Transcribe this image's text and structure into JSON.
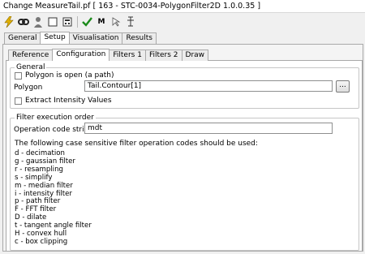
{
  "window": {
    "title": "Change MeasureTail.pf [ 163 - STC-0034-PolygonFilter2D 1.0.0.35 ]"
  },
  "toolbar": {
    "icons": [
      "lightning-icon",
      "link-icon",
      "person-icon",
      "square-icon",
      "calculator-icon",
      "checkmark-icon",
      "m-text",
      "cursor-icon",
      "text-cursor-icon"
    ],
    "m_label": "M"
  },
  "tabs_main": [
    "General",
    "Setup",
    "Visualisation",
    "Results"
  ],
  "tabs_main_active": "Setup",
  "tabs_setup": [
    "Reference",
    "Configuration",
    "Filters 1",
    "Filters 2",
    "Draw"
  ],
  "tabs_setup_active": "Configuration",
  "general_group": {
    "legend": "General",
    "polygon_open_label": "Polygon is open (a path)",
    "polygon_open_checked": false,
    "polygon_label": "Polygon",
    "polygon_value": "Tail.Contour[1]",
    "browse_label": "...",
    "extract_intensity_label": "Extract Intensity Values",
    "extract_intensity_checked": false
  },
  "filter_group": {
    "legend": "Filter execution order",
    "opcode_label": "Operation code string",
    "opcode_value": "mdt",
    "help_intro": "The following case sensitive filter operation codes should be used:",
    "codes": [
      "d - decimation",
      "g - gaussian filter",
      "r - resampling",
      "s - simplify",
      "m - median filter",
      "i - intensity filter",
      "p - path filter",
      "F - FFT filter",
      "D - dilate",
      "t - tangent angle filter",
      "H - convex hull",
      "c - box clipping"
    ]
  },
  "colors": {
    "check_green": "#1a8a1a",
    "lightning": "#e0b000",
    "tab_border": "#a9a9a9"
  }
}
